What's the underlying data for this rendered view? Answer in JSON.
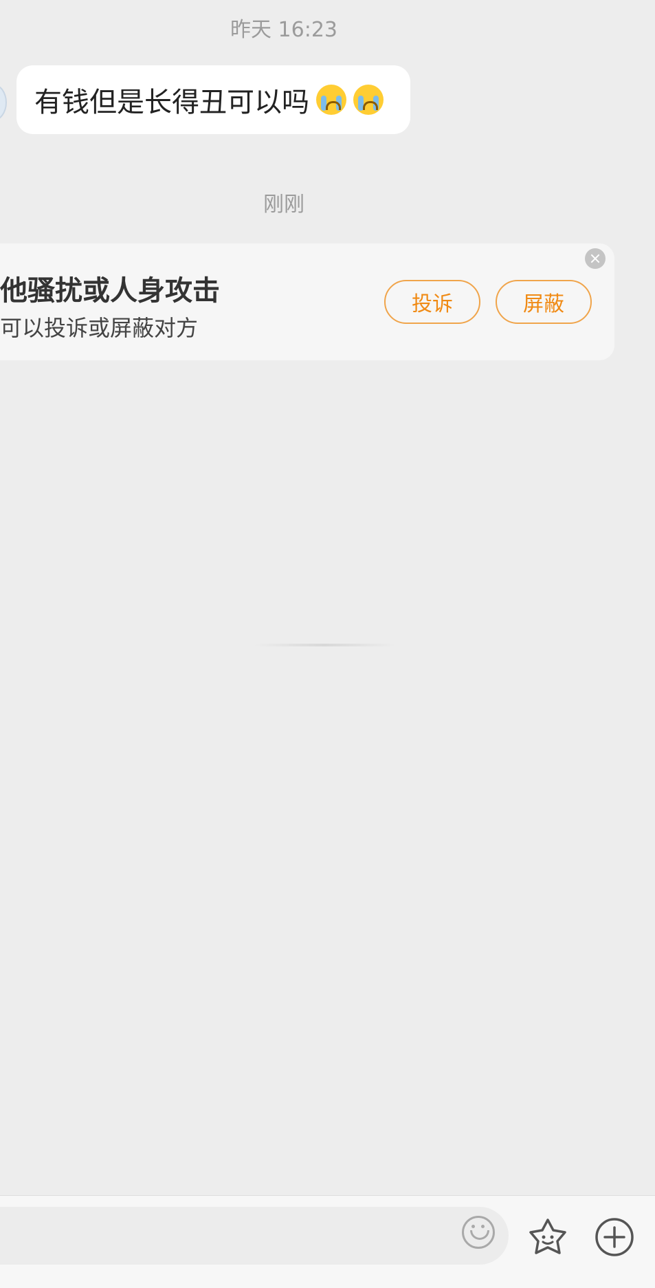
{
  "chat": {
    "timestamp_1": "昨天 16:23",
    "message_1": "有钱但是长得丑可以吗",
    "timestamp_2": "刚刚"
  },
  "notice": {
    "title": "遇到其他骚扰或人身攻击",
    "title_visible": "他骚扰或人身攻击",
    "subtitle_visible": "可以投诉或屏蔽对方",
    "report_label": "投诉",
    "block_label": "屏蔽"
  },
  "input_bar": {
    "icons": [
      "emoji-icon",
      "favorite-sticker-icon",
      "plus-icon"
    ]
  },
  "colors": {
    "background": "#ededed",
    "accent": "#f08a14"
  }
}
